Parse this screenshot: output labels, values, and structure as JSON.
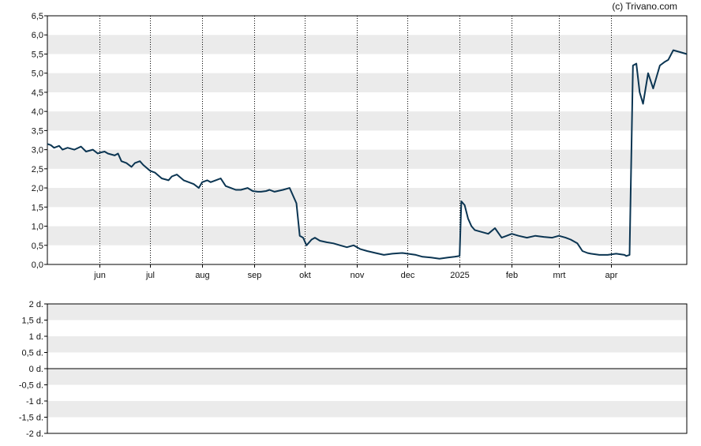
{
  "credit": "(c) Trivano.com",
  "colors": {
    "line": "#0b3552",
    "band": "#ebebeb",
    "axis": "#000000",
    "grid": "#000000"
  },
  "chart_data": [
    {
      "type": "line",
      "ylim": [
        0,
        6.5
      ],
      "grid": true,
      "yticks": [
        "0,0",
        "0,5",
        "1,0",
        "1,5",
        "2,0",
        "2,5",
        "3,0",
        "3,5",
        "4,0",
        "4,5",
        "5,0",
        "5,5",
        "6,0",
        "6,5"
      ],
      "ytick_values": [
        0,
        0.5,
        1,
        1.5,
        2,
        2.5,
        3,
        3.5,
        4,
        4.5,
        5,
        5.5,
        6,
        6.5
      ],
      "xticks": [
        "jun",
        "jul",
        "aug",
        "sep",
        "okt",
        "nov",
        "dec",
        "2025",
        "feb",
        "mrt",
        "apr"
      ],
      "xtick_dates": [
        "2024-06-01",
        "2024-07-01",
        "2024-08-01",
        "2024-09-01",
        "2024-10-01",
        "2024-11-01",
        "2024-12-01",
        "2025-01-01",
        "2025-02-01",
        "2025-03-01",
        "2025-04-01"
      ],
      "xlim": [
        "2024-05-01",
        "2025-05-16"
      ],
      "series": [
        {
          "x": [
            "2024-05-01",
            "2024-05-03",
            "2024-05-05",
            "2024-05-08",
            "2024-05-10",
            "2024-05-13",
            "2024-05-17",
            "2024-05-21",
            "2024-05-24",
            "2024-05-28",
            "2024-05-31",
            "2024-06-01",
            "2024-06-04",
            "2024-06-06",
            "2024-06-10",
            "2024-06-12",
            "2024-06-14",
            "2024-06-17",
            "2024-06-20",
            "2024-06-22",
            "2024-06-25",
            "2024-06-27",
            "2024-07-01",
            "2024-07-04",
            "2024-07-08",
            "2024-07-12",
            "2024-07-14",
            "2024-07-17",
            "2024-07-21",
            "2024-07-24",
            "2024-07-27",
            "2024-07-30",
            "2024-08-01",
            "2024-08-04",
            "2024-08-06",
            "2024-08-09",
            "2024-08-12",
            "2024-08-15",
            "2024-08-18",
            "2024-08-21",
            "2024-08-24",
            "2024-08-28",
            "2024-08-31",
            "2024-09-03",
            "2024-09-05",
            "2024-09-08",
            "2024-09-10",
            "2024-09-13",
            "2024-09-18",
            "2024-09-22",
            "2024-09-26",
            "2024-09-28",
            "2024-09-30",
            "2024-10-01",
            "2024-10-02",
            "2024-10-05",
            "2024-10-07",
            "2024-10-10",
            "2024-10-14",
            "2024-10-18",
            "2024-10-22",
            "2024-10-26",
            "2024-10-30",
            "2024-11-03",
            "2024-11-07",
            "2024-11-12",
            "2024-11-17",
            "2024-11-22",
            "2024-11-28",
            "2024-12-01",
            "2024-12-06",
            "2024-12-10",
            "2024-12-15",
            "2024-12-20",
            "2024-12-25",
            "2024-12-29",
            "2025-01-01",
            "2025-01-02",
            "2025-01-04",
            "2025-01-06",
            "2025-01-08",
            "2025-01-10",
            "2025-01-14",
            "2025-01-18",
            "2025-01-22",
            "2025-01-26",
            "2025-01-29",
            "2025-02-01",
            "2025-02-05",
            "2025-02-10",
            "2025-02-15",
            "2025-02-20",
            "2025-02-25",
            "2025-03-01",
            "2025-03-05",
            "2025-03-08",
            "2025-03-12",
            "2025-03-15",
            "2025-03-18",
            "2025-03-20",
            "2025-03-25",
            "2025-03-30",
            "2025-04-04",
            "2025-04-09",
            "2025-04-10",
            "2025-04-12",
            "2025-04-14",
            "2025-04-16",
            "2025-04-18",
            "2025-04-20",
            "2025-04-23",
            "2025-04-26",
            "2025-04-30",
            "2025-05-03",
            "2025-05-05",
            "2025-05-08",
            "2025-05-12",
            "2025-05-16"
          ],
          "values": [
            3.15,
            3.12,
            3.05,
            3.1,
            3.0,
            3.05,
            3.0,
            3.08,
            2.95,
            3.0,
            2.9,
            2.92,
            2.95,
            2.9,
            2.85,
            2.9,
            2.7,
            2.65,
            2.55,
            2.65,
            2.7,
            2.6,
            2.45,
            2.4,
            2.25,
            2.2,
            2.3,
            2.35,
            2.2,
            2.15,
            2.1,
            2.0,
            2.15,
            2.2,
            2.15,
            2.2,
            2.25,
            2.05,
            2.0,
            1.95,
            1.95,
            2.0,
            1.92,
            1.9,
            1.9,
            1.92,
            1.95,
            1.9,
            1.95,
            2.0,
            1.6,
            0.75,
            0.7,
            0.6,
            0.5,
            0.65,
            0.7,
            0.62,
            0.58,
            0.55,
            0.5,
            0.45,
            0.5,
            0.4,
            0.35,
            0.3,
            0.25,
            0.28,
            0.3,
            0.28,
            0.25,
            0.2,
            0.18,
            0.15,
            0.18,
            0.2,
            0.22,
            1.65,
            1.55,
            1.2,
            1.0,
            0.9,
            0.85,
            0.8,
            0.95,
            0.7,
            0.75,
            0.8,
            0.75,
            0.7,
            0.75,
            0.72,
            0.7,
            0.75,
            0.7,
            0.65,
            0.55,
            0.35,
            0.3,
            0.28,
            0.25,
            0.25,
            0.28,
            0.25,
            0.22,
            0.25,
            5.2,
            5.25,
            4.5,
            4.2,
            5.0,
            4.6,
            5.2,
            5.3,
            5.35,
            5.6,
            5.55,
            5.5
          ]
        }
      ]
    },
    {
      "type": "line",
      "ylim": [
        -2,
        2
      ],
      "grid": true,
      "yticks": [
        "2 d.",
        "1,5 d.",
        "1 d.",
        "0,5 d.",
        "0 d.",
        "-0,5 d.",
        "-1 d.",
        "-1,5 d.",
        "-2 d."
      ],
      "ytick_values": [
        2,
        1.5,
        1,
        0.5,
        0,
        -0.5,
        -1,
        -1.5,
        -2
      ],
      "series": []
    }
  ]
}
